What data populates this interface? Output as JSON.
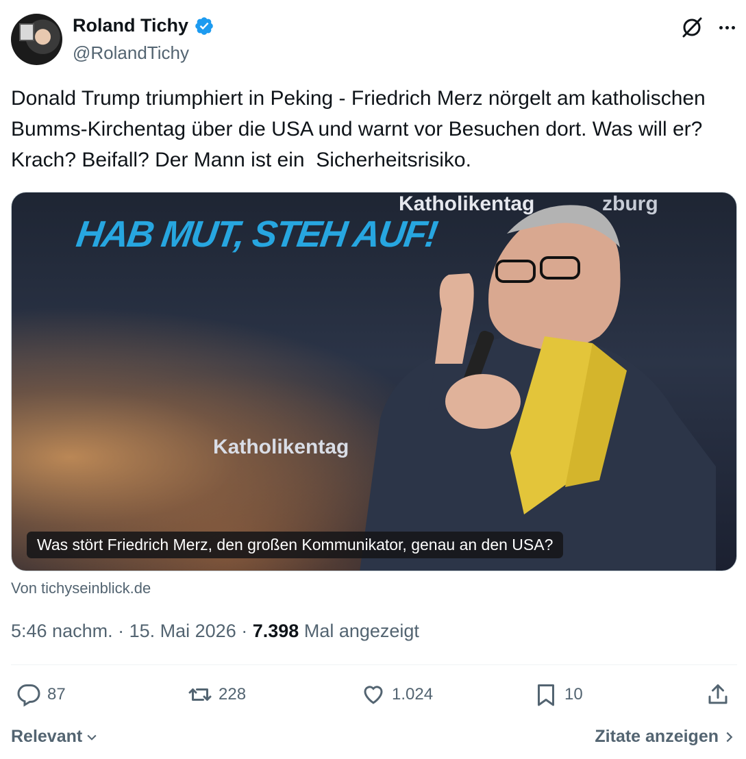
{
  "author": {
    "display_name": "Roland Tichy",
    "handle": "@RolandTichy",
    "verified_color": "#1d9bf0"
  },
  "header_icons": {
    "grok": "grok-icon",
    "more": "more-icon"
  },
  "tweet": {
    "text": "Donald Trump triumphiert in Peking - Friedrich Merz nörgelt am katholischen Bumms-Kirchentag über die USA und warnt vor Besuchen dort. Was will er? Krach? Beifall? Der Mann ist ein  Sicherheitsrisiko."
  },
  "media": {
    "banner_text": "HAB MUT, STEH AUF!",
    "sign_top": "Katholikentag",
    "sign_top_right": "zburg",
    "sign_bottom": "Katholikentag",
    "caption": "Was stört Friedrich Merz, den großen Kommunikator, genau an den USA?",
    "source": "Von tichyseinblick.de"
  },
  "meta": {
    "time": "5:46 nachm.",
    "date": "15. Mai 2026",
    "views": "7.398",
    "views_label": "Mal angezeigt"
  },
  "actions": {
    "replies": "87",
    "reposts": "228",
    "likes": "1.024",
    "bookmarks": "10"
  },
  "footer": {
    "sort_label": "Relevant",
    "quotes_label": "Zitate anzeigen"
  }
}
